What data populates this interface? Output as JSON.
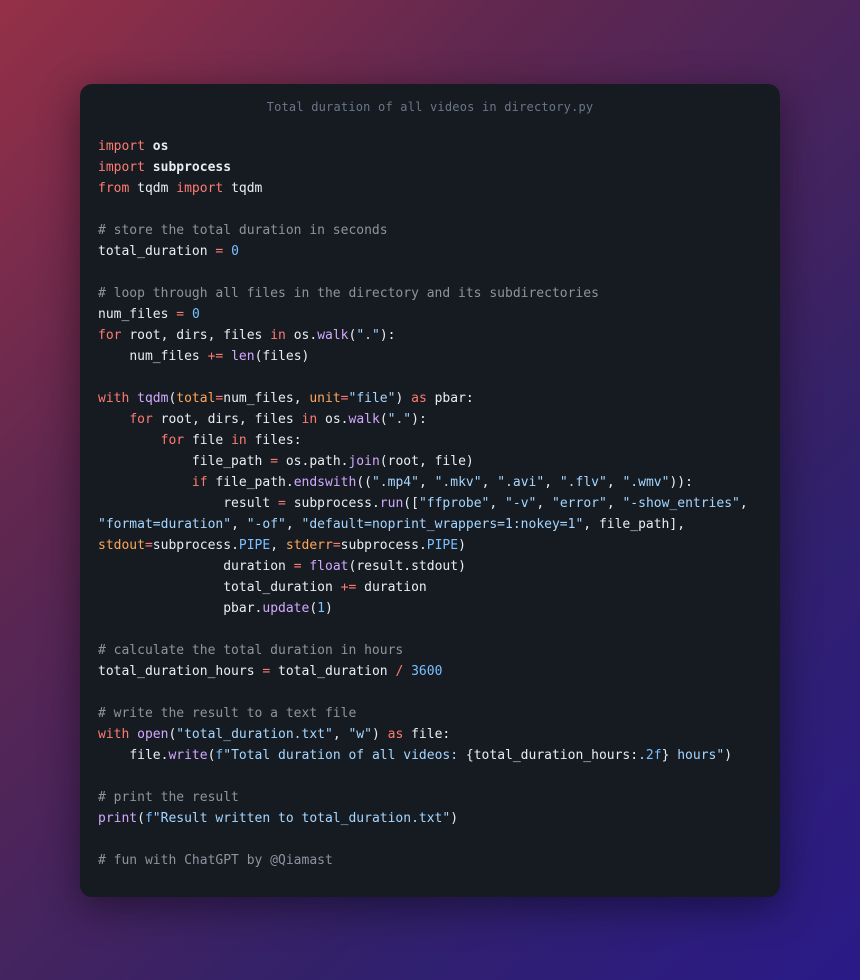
{
  "title": "Total duration of all videos in directory.py",
  "code": {
    "lines": [
      [
        [
          "kw",
          "import"
        ],
        [
          "sp",
          " "
        ],
        [
          "mod",
          "os"
        ]
      ],
      [
        [
          "kw",
          "import"
        ],
        [
          "sp",
          " "
        ],
        [
          "mod",
          "subprocess"
        ]
      ],
      [
        [
          "kw",
          "from"
        ],
        [
          "sp",
          " "
        ],
        [
          "var",
          "tqdm"
        ],
        [
          "sp",
          " "
        ],
        [
          "kw",
          "import"
        ],
        [
          "sp",
          " "
        ],
        [
          "var",
          "tqdm"
        ]
      ],
      [],
      [
        [
          "cmt",
          "# store the total duration in seconds"
        ]
      ],
      [
        [
          "var",
          "total_duration"
        ],
        [
          "sp",
          " "
        ],
        [
          "op",
          "="
        ],
        [
          "sp",
          " "
        ],
        [
          "num",
          "0"
        ]
      ],
      [],
      [
        [
          "cmt",
          "# loop through all files in the directory and its subdirectories"
        ]
      ],
      [
        [
          "var",
          "num_files"
        ],
        [
          "sp",
          " "
        ],
        [
          "op",
          "="
        ],
        [
          "sp",
          " "
        ],
        [
          "num",
          "0"
        ]
      ],
      [
        [
          "kw",
          "for"
        ],
        [
          "sp",
          " "
        ],
        [
          "var",
          "root"
        ],
        [
          "par",
          ", "
        ],
        [
          "var",
          "dirs"
        ],
        [
          "par",
          ", "
        ],
        [
          "var",
          "files"
        ],
        [
          "sp",
          " "
        ],
        [
          "kw",
          "in"
        ],
        [
          "sp",
          " "
        ],
        [
          "var",
          "os"
        ],
        [
          "par",
          "."
        ],
        [
          "fn",
          "walk"
        ],
        [
          "par",
          "("
        ],
        [
          "str",
          "\".\""
        ],
        [
          "par",
          ")"
        ],
        [
          "par",
          ":"
        ]
      ],
      [
        [
          "sp",
          "    "
        ],
        [
          "var",
          "num_files"
        ],
        [
          "sp",
          " "
        ],
        [
          "op",
          "+="
        ],
        [
          "sp",
          " "
        ],
        [
          "fn",
          "len"
        ],
        [
          "par",
          "("
        ],
        [
          "var",
          "files"
        ],
        [
          "par",
          ")"
        ]
      ],
      [],
      [
        [
          "kw",
          "with"
        ],
        [
          "sp",
          " "
        ],
        [
          "fn",
          "tqdm"
        ],
        [
          "par",
          "("
        ],
        [
          "arg",
          "total"
        ],
        [
          "op",
          "="
        ],
        [
          "var",
          "num_files"
        ],
        [
          "par",
          ", "
        ],
        [
          "arg",
          "unit"
        ],
        [
          "op",
          "="
        ],
        [
          "str",
          "\"file\""
        ],
        [
          "par",
          ")"
        ],
        [
          "sp",
          " "
        ],
        [
          "kw",
          "as"
        ],
        [
          "sp",
          " "
        ],
        [
          "var",
          "pbar"
        ],
        [
          "par",
          ":"
        ]
      ],
      [
        [
          "sp",
          "    "
        ],
        [
          "kw",
          "for"
        ],
        [
          "sp",
          " "
        ],
        [
          "var",
          "root"
        ],
        [
          "par",
          ", "
        ],
        [
          "var",
          "dirs"
        ],
        [
          "par",
          ", "
        ],
        [
          "var",
          "files"
        ],
        [
          "sp",
          " "
        ],
        [
          "kw",
          "in"
        ],
        [
          "sp",
          " "
        ],
        [
          "var",
          "os"
        ],
        [
          "par",
          "."
        ],
        [
          "fn",
          "walk"
        ],
        [
          "par",
          "("
        ],
        [
          "str",
          "\".\""
        ],
        [
          "par",
          ")"
        ],
        [
          "par",
          ":"
        ]
      ],
      [
        [
          "sp",
          "        "
        ],
        [
          "kw",
          "for"
        ],
        [
          "sp",
          " "
        ],
        [
          "var",
          "file"
        ],
        [
          "sp",
          " "
        ],
        [
          "kw",
          "in"
        ],
        [
          "sp",
          " "
        ],
        [
          "var",
          "files"
        ],
        [
          "par",
          ":"
        ]
      ],
      [
        [
          "sp",
          "            "
        ],
        [
          "var",
          "file_path"
        ],
        [
          "sp",
          " "
        ],
        [
          "op",
          "="
        ],
        [
          "sp",
          " "
        ],
        [
          "var",
          "os"
        ],
        [
          "par",
          "."
        ],
        [
          "var",
          "path"
        ],
        [
          "par",
          "."
        ],
        [
          "fn",
          "join"
        ],
        [
          "par",
          "("
        ],
        [
          "var",
          "root"
        ],
        [
          "par",
          ", "
        ],
        [
          "var",
          "file"
        ],
        [
          "par",
          ")"
        ]
      ],
      [
        [
          "sp",
          "            "
        ],
        [
          "kw",
          "if"
        ],
        [
          "sp",
          " "
        ],
        [
          "var",
          "file_path"
        ],
        [
          "par",
          "."
        ],
        [
          "fn",
          "endswith"
        ],
        [
          "par",
          "(("
        ],
        [
          "str",
          "\".mp4\""
        ],
        [
          "par",
          ", "
        ],
        [
          "str",
          "\".mkv\""
        ],
        [
          "par",
          ", "
        ],
        [
          "str",
          "\".avi\""
        ],
        [
          "par",
          ", "
        ],
        [
          "str",
          "\".flv\""
        ],
        [
          "par",
          ", "
        ],
        [
          "str",
          "\".wmv\""
        ],
        [
          "par",
          "))"
        ],
        [
          "par",
          ":"
        ]
      ],
      [
        [
          "sp",
          "                "
        ],
        [
          "var",
          "result"
        ],
        [
          "sp",
          " "
        ],
        [
          "op",
          "="
        ],
        [
          "sp",
          " "
        ],
        [
          "var",
          "subprocess"
        ],
        [
          "par",
          "."
        ],
        [
          "fn",
          "run"
        ],
        [
          "par",
          "(["
        ],
        [
          "str",
          "\"ffprobe\""
        ],
        [
          "par",
          ", "
        ],
        [
          "str",
          "\"-v\""
        ],
        [
          "par",
          ", "
        ],
        [
          "str",
          "\"error\""
        ],
        [
          "par",
          ", "
        ],
        [
          "str",
          "\"-show_entries\""
        ],
        [
          "par",
          ", "
        ],
        [
          "str",
          "\"format=duration\""
        ],
        [
          "par",
          ", "
        ],
        [
          "str",
          "\"-of\""
        ],
        [
          "par",
          ", "
        ],
        [
          "str",
          "\"default=noprint_wrappers=1:nokey=1\""
        ],
        [
          "par",
          ", "
        ],
        [
          "var",
          "file_path"
        ],
        [
          "par",
          "], "
        ],
        [
          "arg",
          "stdout"
        ],
        [
          "op",
          "="
        ],
        [
          "var",
          "subprocess"
        ],
        [
          "par",
          "."
        ],
        [
          "bool",
          "PIPE"
        ],
        [
          "par",
          ", "
        ],
        [
          "arg",
          "stderr"
        ],
        [
          "op",
          "="
        ],
        [
          "var",
          "subprocess"
        ],
        [
          "par",
          "."
        ],
        [
          "bool",
          "PIPE"
        ],
        [
          "par",
          ")"
        ]
      ],
      [
        [
          "sp",
          "                "
        ],
        [
          "var",
          "duration"
        ],
        [
          "sp",
          " "
        ],
        [
          "op",
          "="
        ],
        [
          "sp",
          " "
        ],
        [
          "fn",
          "float"
        ],
        [
          "par",
          "("
        ],
        [
          "var",
          "result"
        ],
        [
          "par",
          "."
        ],
        [
          "var",
          "stdout"
        ],
        [
          "par",
          ")"
        ]
      ],
      [
        [
          "sp",
          "                "
        ],
        [
          "var",
          "total_duration"
        ],
        [
          "sp",
          " "
        ],
        [
          "op",
          "+="
        ],
        [
          "sp",
          " "
        ],
        [
          "var",
          "duration"
        ]
      ],
      [
        [
          "sp",
          "                "
        ],
        [
          "var",
          "pbar"
        ],
        [
          "par",
          "."
        ],
        [
          "fn",
          "update"
        ],
        [
          "par",
          "("
        ],
        [
          "num",
          "1"
        ],
        [
          "par",
          ")"
        ]
      ],
      [],
      [
        [
          "cmt",
          "# calculate the total duration in hours"
        ]
      ],
      [
        [
          "var",
          "total_duration_hours"
        ],
        [
          "sp",
          " "
        ],
        [
          "op",
          "="
        ],
        [
          "sp",
          " "
        ],
        [
          "var",
          "total_duration"
        ],
        [
          "sp",
          " "
        ],
        [
          "op",
          "/"
        ],
        [
          "sp",
          " "
        ],
        [
          "num",
          "3600"
        ]
      ],
      [],
      [
        [
          "cmt",
          "# write the result to a text file"
        ]
      ],
      [
        [
          "kw",
          "with"
        ],
        [
          "sp",
          " "
        ],
        [
          "fn",
          "open"
        ],
        [
          "par",
          "("
        ],
        [
          "str",
          "\"total_duration.txt\""
        ],
        [
          "par",
          ", "
        ],
        [
          "str",
          "\"w\""
        ],
        [
          "par",
          ")"
        ],
        [
          "sp",
          " "
        ],
        [
          "kw",
          "as"
        ],
        [
          "sp",
          " "
        ],
        [
          "var",
          "file"
        ],
        [
          "par",
          ":"
        ]
      ],
      [
        [
          "sp",
          "    "
        ],
        [
          "var",
          "file"
        ],
        [
          "par",
          "."
        ],
        [
          "fn",
          "write"
        ],
        [
          "par",
          "("
        ],
        [
          "fstr",
          "f"
        ],
        [
          "str",
          "\"Total duration of all videos: "
        ],
        [
          "par",
          "{"
        ],
        [
          "emb",
          "total_duration_hours"
        ],
        [
          "par",
          ":"
        ],
        [
          "str",
          "."
        ],
        [
          "num",
          "2"
        ],
        [
          "fstr",
          "f"
        ],
        [
          "par",
          "}"
        ],
        [
          "str",
          " hours\""
        ],
        [
          "par",
          ")"
        ]
      ],
      [],
      [
        [
          "cmt",
          "# print the result"
        ]
      ],
      [
        [
          "fn",
          "print"
        ],
        [
          "par",
          "("
        ],
        [
          "fstr",
          "f"
        ],
        [
          "str",
          "\"Result written to total_duration.txt\""
        ],
        [
          "par",
          ")"
        ]
      ],
      [],
      [
        [
          "cmt",
          "# fun with ChatGPT by @Qiamast"
        ]
      ]
    ]
  }
}
